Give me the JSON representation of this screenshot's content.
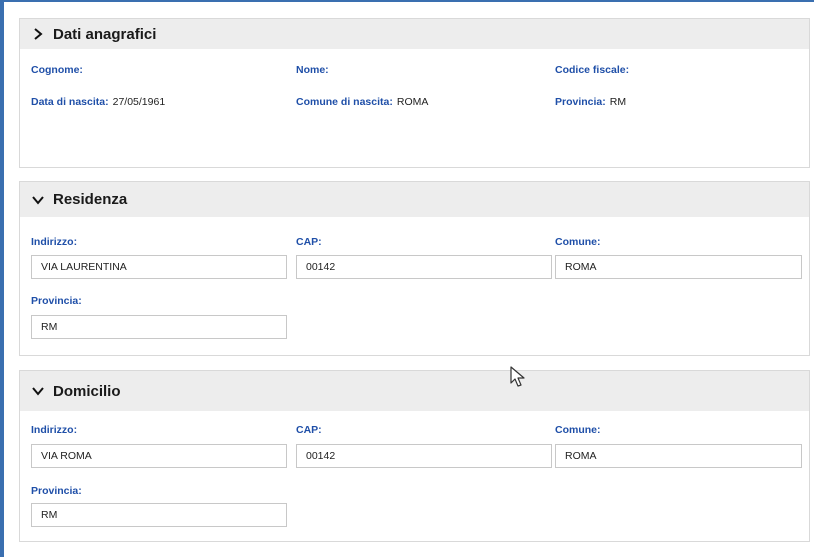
{
  "anagrafici": {
    "title": "Dati anagrafici",
    "cognome_label": "Cognome:",
    "nome_label": "Nome:",
    "codice_fiscale_label": "Codice fiscale:",
    "data_nascita_label": "Data di nascita:",
    "data_nascita_value": "27/05/1961",
    "comune_nascita_label": "Comune di nascita:",
    "comune_nascita_value": "ROMA",
    "provincia_label": "Provincia:",
    "provincia_value": "RM"
  },
  "residenza": {
    "title": "Residenza",
    "indirizzo_label": "Indirizzo:",
    "indirizzo_value": "VIA LAURENTINA",
    "cap_label": "CAP:",
    "cap_value": "00142",
    "comune_label": "Comune:",
    "comune_value": "ROMA",
    "provincia_label": "Provincia:",
    "provincia_value": "RM"
  },
  "domicilio": {
    "title": "Domicilio",
    "indirizzo_label": "Indirizzo:",
    "indirizzo_value": "VIA ROMA",
    "cap_label": "CAP:",
    "cap_value": "00142",
    "comune_label": "Comune:",
    "comune_value": "ROMA",
    "provincia_label": "Provincia:",
    "provincia_value": "RM"
  },
  "icons": {
    "collapsed": "chevron-right-icon",
    "expanded": "chevron-down-icon",
    "pointer": "mouse-cursor-icon"
  },
  "colors": {
    "label": "#1f4fa8",
    "header_bg": "#ededed",
    "border": "#d9d9d9",
    "frame": "#3a6fb0"
  }
}
